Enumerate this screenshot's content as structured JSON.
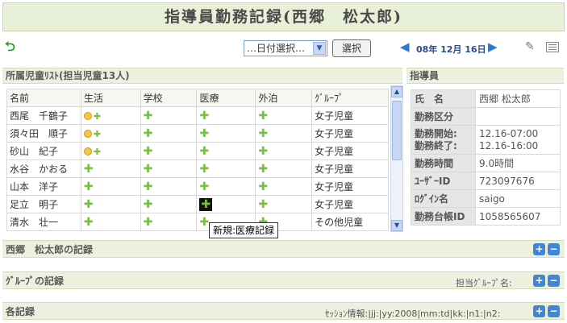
{
  "title": "指導員勤務記録(西郷　松太郎)",
  "toolbar": {
    "date_select_value": "…日付選択…",
    "select_button": "選択",
    "date_label": "08年 12月 16日"
  },
  "students_panel": {
    "header": "所属児童ﾘｽﾄ(担当児童13人)",
    "columns": [
      "名前",
      "生活",
      "学校",
      "医療",
      "外泊",
      "ｸﾞﾙｰﾌﾟ"
    ],
    "rows": [
      {
        "name": "西尾　千鶴子",
        "group": "女子児童",
        "life": "smile"
      },
      {
        "name": "須々田　順子",
        "group": "女子児童",
        "life": "smile"
      },
      {
        "name": "砂山　紀子",
        "group": "女子児童",
        "life": "smile"
      },
      {
        "name": "水谷　かおる",
        "group": "女子児童",
        "life": "plus"
      },
      {
        "name": "山本　洋子",
        "group": "女子児童",
        "life": "plus"
      },
      {
        "name": "足立　明子",
        "group": "女子児童",
        "life": "plus"
      },
      {
        "name": "清水　壮一",
        "group": "その他児童",
        "life": "plus"
      }
    ],
    "tooltip": "新規:医療記録"
  },
  "staff_panel": {
    "header": "指導員",
    "rows": [
      {
        "key": "氏　名",
        "value": "西郷 松太郎"
      },
      {
        "key": "勤務区分",
        "value": ""
      },
      {
        "key": "勤務開始:\n勤務終了:",
        "value": "12.16-07:00\n12.16-16:00"
      },
      {
        "key": "勤務時間",
        "value": "9.0時間"
      },
      {
        "key": "ﾕｰｻﾞｰID",
        "value": "723097676"
      },
      {
        "key": "ﾛｸﾞｲﾝ名",
        "value": "saigo"
      },
      {
        "key": "勤務台帳ID",
        "value": "1058565607"
      }
    ]
  },
  "sections": {
    "staff_record": "西郷　松太郎の記録",
    "group_record": "ｸﾞﾙｰﾌﾟの記録",
    "group_right": "担当ｸﾞﾙｰﾌﾟ名:",
    "each_record": "各記録",
    "session_info": "ｾｯｼｮﾝ情報:|jj:|yy:2008|mm:td|kk:|n1:|n2:"
  }
}
